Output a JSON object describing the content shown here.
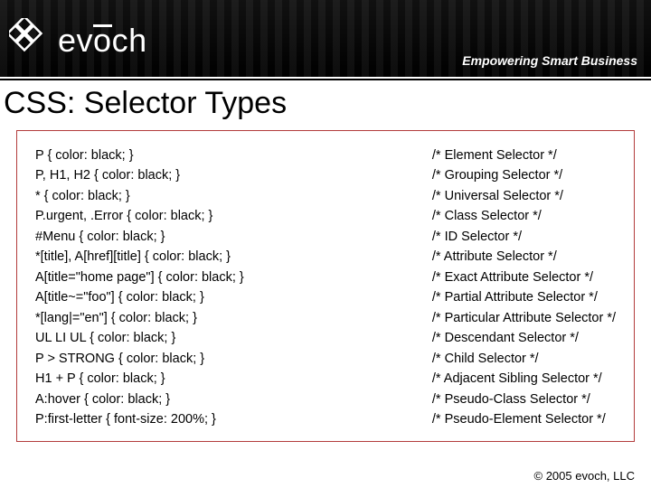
{
  "header": {
    "brand_text": "evoch",
    "tagline": "Empowering Smart Business"
  },
  "title": "CSS: Selector Types",
  "selectors": [
    {
      "code": "P { color: black; }",
      "desc": "/* Element Selector */"
    },
    {
      "code": "P, H1, H2 { color: black; }",
      "desc": "/* Grouping Selector */"
    },
    {
      "code": "* { color: black; }",
      "desc": "/* Universal Selector */"
    },
    {
      "code": "P.urgent, .Error { color: black; }",
      "desc": "/* Class Selector */"
    },
    {
      "code": "#Menu { color: black; }",
      "desc": "/* ID Selector */"
    },
    {
      "code": "*[title], A[href][title] { color: black; }",
      "desc": "/* Attribute Selector */"
    },
    {
      "code": "A[title=\"home page\"] { color: black; }",
      "desc": "/* Exact Attribute Selector */"
    },
    {
      "code": "A[title~=\"foo\"] { color: black; }",
      "desc": "/* Partial Attribute Selector */"
    },
    {
      "code": "*[lang|=\"en\"] { color: black; }",
      "desc": "/* Particular Attribute Selector */"
    },
    {
      "code": "UL LI UL { color: black; }",
      "desc": "/* Descendant Selector */"
    },
    {
      "code": "P > STRONG { color: black; }",
      "desc": "/* Child Selector */"
    },
    {
      "code": "H1 + P { color: black; }",
      "desc": "/* Adjacent Sibling Selector */"
    },
    {
      "code": "A:hover { color: black; }",
      "desc": "/* Pseudo-Class Selector */"
    },
    {
      "code": "P:first-letter { font-size: 200%; }",
      "desc": "/* Pseudo-Element Selector */"
    }
  ],
  "footer": "© 2005 evoch, LLC"
}
